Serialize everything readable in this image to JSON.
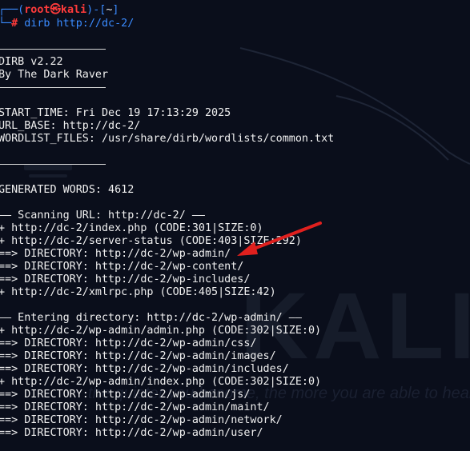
{
  "prompt": {
    "user": "root",
    "skull": "㉿",
    "host": "kali",
    "cwd": "~",
    "symbol": "#",
    "command": "dirb http://dc-2/"
  },
  "banner": {
    "version": "DIRB v2.22",
    "author": "By The Dark Raver"
  },
  "info": {
    "start_time": "START_TIME: Fri Dec 19 17:13:29 2025",
    "url_base": "URL_BASE: http://dc-2/",
    "wordlist": "WORDLIST_FILES: /usr/share/dirb/wordlists/common.txt"
  },
  "generated": "GENERATED WORDS: 4612",
  "scan": {
    "header": "—— Scanning URL: http://dc-2/ ——",
    "results": [
      "+ http://dc-2/index.php (CODE:301|SIZE:0)",
      "+ http://dc-2/server-status (CODE:403|SIZE:292)",
      "==> DIRECTORY: http://dc-2/wp-admin/",
      "==> DIRECTORY: http://dc-2/wp-content/",
      "==> DIRECTORY: http://dc-2/wp-includes/",
      "+ http://dc-2/xmlrpc.php (CODE:405|SIZE:42)"
    ]
  },
  "entering": {
    "header": "—— Entering directory: http://dc-2/wp-admin/ ——",
    "results": [
      "+ http://dc-2/wp-admin/admin.php (CODE:302|SIZE:0)",
      "==> DIRECTORY: http://dc-2/wp-admin/css/",
      "==> DIRECTORY: http://dc-2/wp-admin/images/",
      "==> DIRECTORY: http://dc-2/wp-admin/includes/",
      "+ http://dc-2/wp-admin/index.php (CODE:302|SIZE:0)",
      "==> DIRECTORY: http://dc-2/wp-admin/js/",
      "==> DIRECTORY: http://dc-2/wp-admin/maint/",
      "==> DIRECTORY: http://dc-2/wp-admin/network/",
      "==> DIRECTORY: http://dc-2/wp-admin/user/"
    ]
  },
  "watermark": {
    "brand": "KALI LINUX",
    "tagline": "the quieter you become, the more you are able to hear"
  },
  "colors": {
    "background": "#0a0e1b",
    "prompt_blue": "#3a8bff",
    "prompt_red": "#ff3b3b",
    "arrow_red": "#e0201e"
  }
}
